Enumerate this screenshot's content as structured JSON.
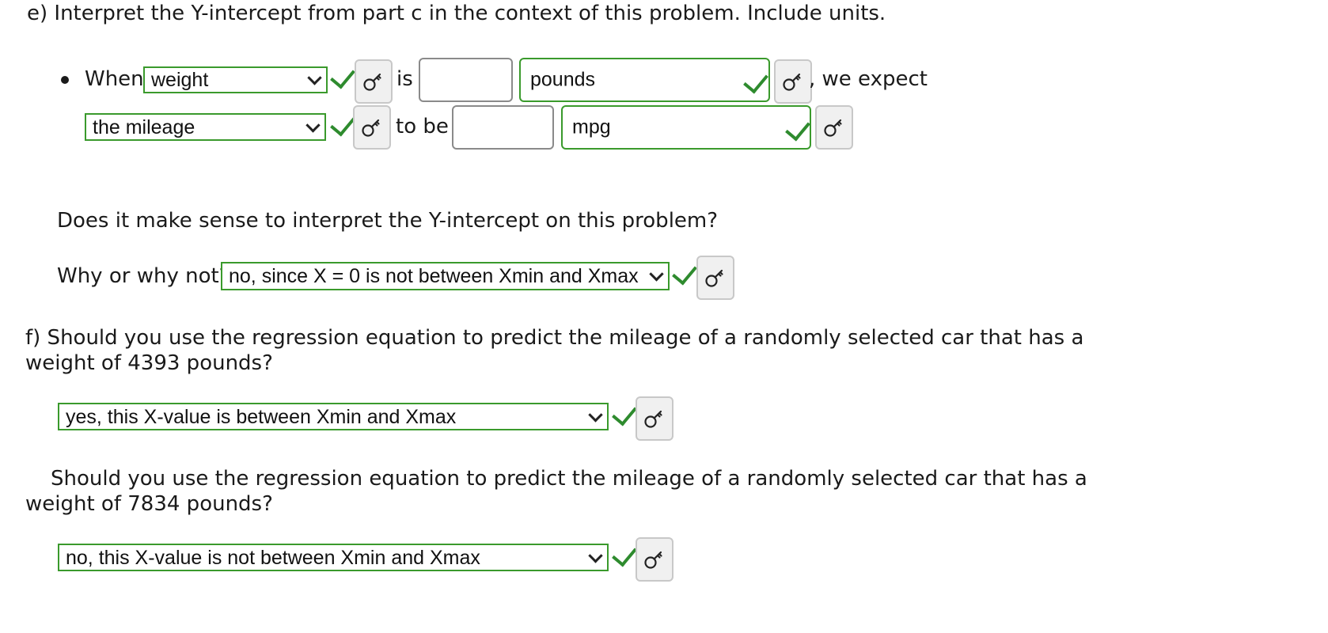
{
  "part_e": {
    "heading": "e) Interpret the Y-intercept from part c in the context of this problem. Include units.",
    "when_label": "When",
    "select1": "weight",
    "is_label": "is",
    "input1_value": "",
    "unit1": "pounds",
    "we_expect": ", we expect",
    "select2": "the mileage",
    "to_be_label": "to be",
    "input2_value": "",
    "unit2": "mpg",
    "question": "Does it make sense to interpret the Y-intercept on this problem?",
    "why_label": "Why or why not?",
    "why_select": "no, since X = 0 is not between Xmin and Xmax"
  },
  "part_f": {
    "q1_line1": "f) Should you use the regression equation to predict the mileage of a randomly selected car that has a",
    "q1_line2": "weight of 4393 pounds?",
    "answer1": "yes, this X-value is between Xmin and Xmax",
    "q2_line1": "Should you use the regression equation to predict the mileage of a randomly selected car that has a",
    "q2_line2": "weight of 7834 pounds?",
    "answer2": "no, this X-value is not between Xmin and Xmax"
  },
  "colors": {
    "correct_border": "#3a9a2c",
    "check": "#2e8b2e"
  },
  "icons": {
    "key": "key-icon",
    "check": "check-icon",
    "chevron": "chevron-down-icon"
  }
}
